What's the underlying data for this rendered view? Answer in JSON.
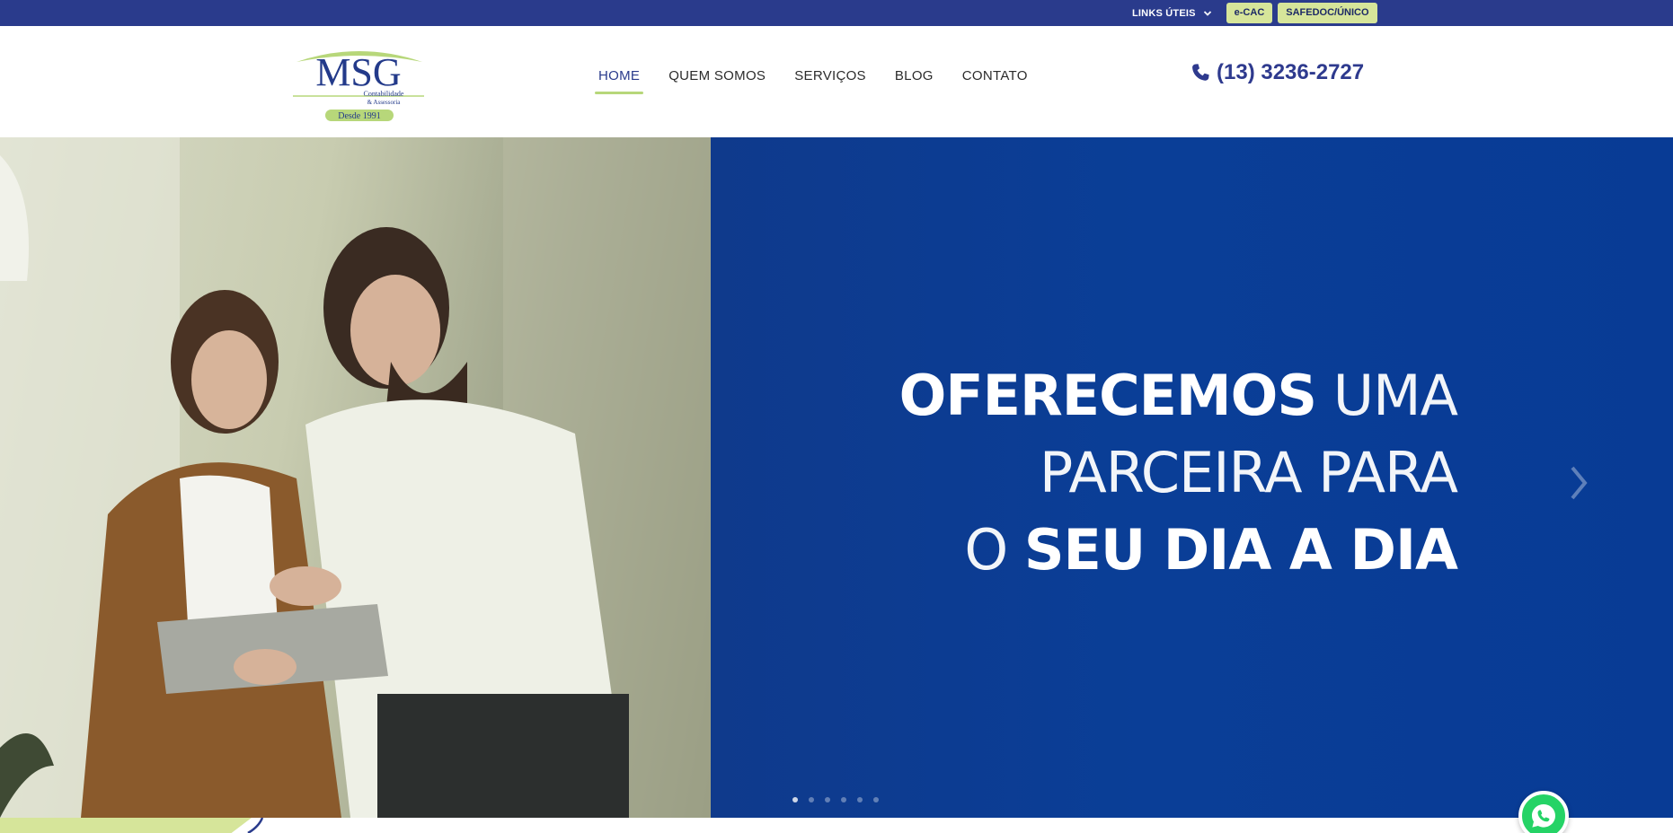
{
  "topbar": {
    "links_label": "LINKS ÚTEIS",
    "buttons": [
      "e-CAC",
      "SAFEDOC/ÚNICO"
    ]
  },
  "logo": {
    "main": "MSG",
    "line1": "Contabilidade",
    "line2": "& Assessoria",
    "since": "Desde 1991"
  },
  "nav": {
    "items": [
      "HOME",
      "QUEM SOMOS",
      "SERVIÇOS",
      "BLOG",
      "CONTATO"
    ],
    "active": "HOME"
  },
  "phone": "(13) 3236-2727",
  "hero": {
    "line1_bold": "OFERECEMOS",
    "line1_light": " UMA",
    "line2_light": "PARCEIRA PARA",
    "line3_light": "O ",
    "line3_bold": "SEU DIA A DIA"
  },
  "slider": {
    "slide_count": 6,
    "active_index": 0
  },
  "colors": {
    "topbar": "#2a3b8c",
    "accent_green": "#d6e59a",
    "hero_blue": "#0a3e97",
    "phone": "#2e3a8e",
    "whatsapp": "#25d366"
  }
}
